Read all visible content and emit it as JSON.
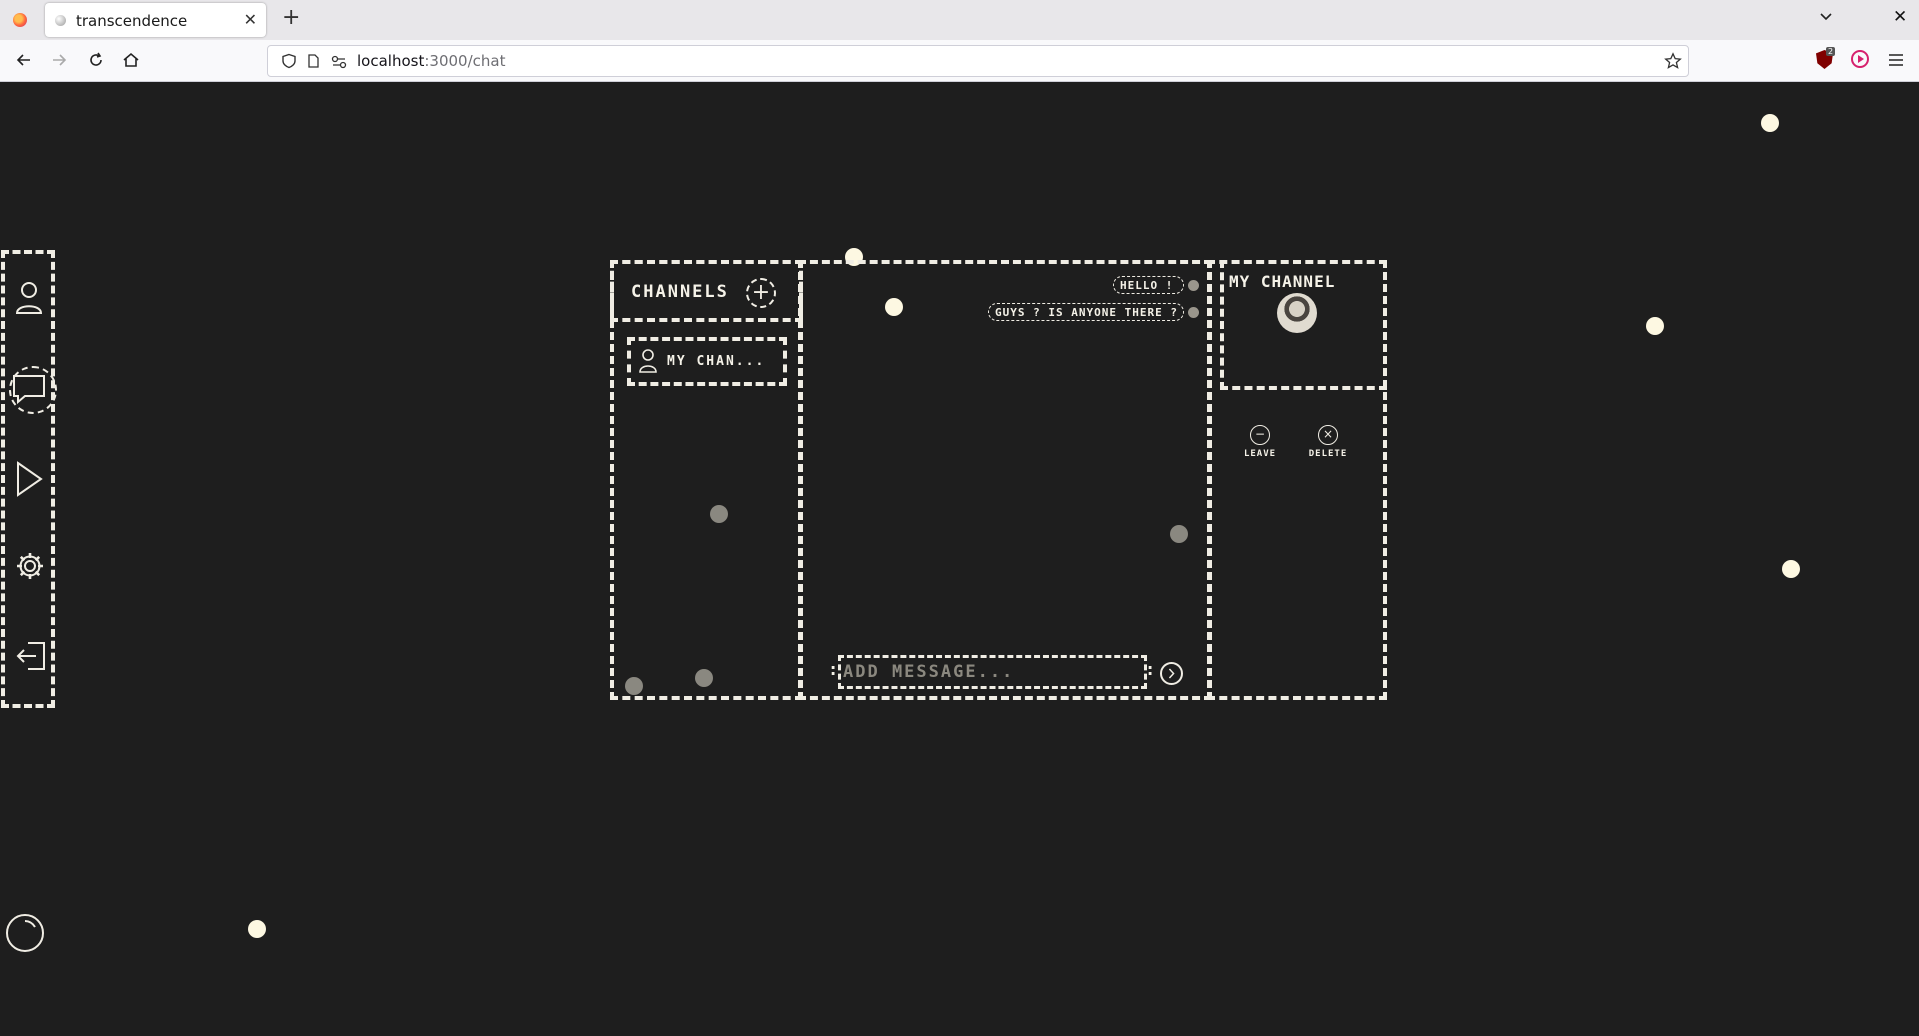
{
  "browser": {
    "tab_title": "transcendence",
    "url_host": "localhost",
    "url_path": ":3000/chat",
    "extension_badge": "2"
  },
  "sidebar": {
    "items": [
      {
        "icon": "user-icon"
      },
      {
        "icon": "chat-icon",
        "active": true
      },
      {
        "icon": "play-icon"
      },
      {
        "icon": "gear-icon"
      },
      {
        "icon": "logout-icon"
      }
    ]
  },
  "channels": {
    "title": "CHANNELS",
    "list": [
      {
        "name": "MY CHAN...",
        "icon": "user-icon"
      }
    ]
  },
  "messages": [
    {
      "text": "HELLO !"
    },
    {
      "text": "GUYS ? IS ANYONE THERE ?"
    }
  ],
  "composer": {
    "placeholder": "ADD MESSAGE..."
  },
  "channel_info": {
    "title": "MY CHANNEL",
    "leave_label": "LEAVE",
    "delete_label": "DELETE"
  },
  "colors": {
    "background": "#1e1e1e",
    "accent": "#f0ede4",
    "dot": "#fdf8e2"
  }
}
